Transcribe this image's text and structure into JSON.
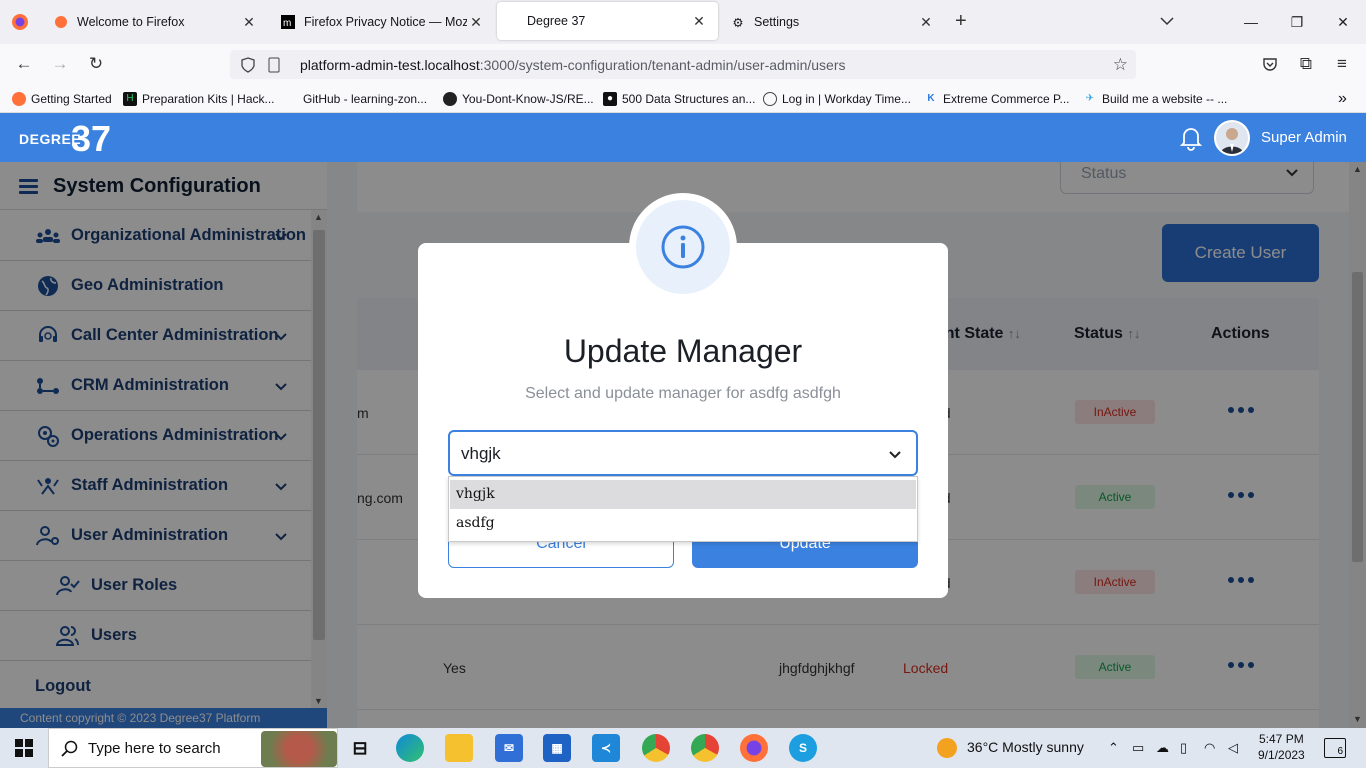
{
  "browser": {
    "tabs": [
      {
        "title": "Welcome to Firefox",
        "active": false
      },
      {
        "title": "Firefox Privacy Notice — Mozill",
        "active": false
      },
      {
        "title": "Degree 37",
        "active": true
      },
      {
        "title": "Settings",
        "active": false
      }
    ],
    "url_host": "platform-admin-test.localhost",
    "url_path": ":3000/system-configuration/tenant-admin/user-admin/users",
    "bookmarks": [
      "Getting Started",
      "Preparation Kits | Hack...",
      "GitHub - learning-zon...",
      "You-Dont-Know-JS/RE...",
      "500 Data Structures an...",
      "Log in | Workday Time...",
      "Extreme Commerce P...",
      "Build me a website -- ..."
    ]
  },
  "app": {
    "logo_small": "DEGREE",
    "logo_big": "37",
    "user_name": "Super Admin",
    "accent": "#3b82e0"
  },
  "sidebar": {
    "title": "System Configuration",
    "items": [
      {
        "label": "Organizational Administration",
        "icon": "org-chart-icon",
        "has_chevron": true
      },
      {
        "label": "Geo Administration",
        "icon": "globe-icon",
        "has_chevron": false
      },
      {
        "label": "Call Center Administration",
        "icon": "headset-icon",
        "has_chevron": true
      },
      {
        "label": "CRM Administration",
        "icon": "network-icon",
        "has_chevron": true
      },
      {
        "label": "Operations Administration",
        "icon": "gears-icon",
        "has_chevron": true
      },
      {
        "label": "Staff Administration",
        "icon": "staff-icon",
        "has_chevron": true
      },
      {
        "label": "User Administration",
        "icon": "user-gear-icon",
        "has_chevron": true
      }
    ],
    "sub_items": [
      {
        "label": "User Roles",
        "icon": "user-check-icon"
      },
      {
        "label": "Users",
        "icon": "users-icon"
      }
    ],
    "logout": "Logout",
    "copyright": "Content copyright © 2023 Degree37 Platform"
  },
  "page": {
    "status_placeholder": "Status",
    "create_user": "Create User",
    "table_headers": [
      "unt State",
      "Status",
      "Actions"
    ],
    "rows": [
      {
        "c1": "m",
        "state": "ed",
        "status": "InActive"
      },
      {
        "c1": "ng.com",
        "state": "ed",
        "status": "Active"
      },
      {
        "c1": "",
        "state": "ed",
        "status": "InActive"
      },
      {
        "c1": "Yes",
        "manager": "jhgfdghjkhgf",
        "state": "Locked",
        "status": "Active"
      }
    ]
  },
  "modal": {
    "title": "Update Manager",
    "subtitle": "Select and update manager for asdfg asdfgh",
    "selected_value": "vhgjk",
    "options": [
      "vhgjk",
      "asdfg"
    ],
    "cancel": "Cancel",
    "update": "Update"
  },
  "taskbar": {
    "search_placeholder": "Type here to search",
    "weather": "36°C  Mostly sunny",
    "time": "5:47 PM",
    "date": "9/1/2023",
    "notif_count": "6"
  }
}
